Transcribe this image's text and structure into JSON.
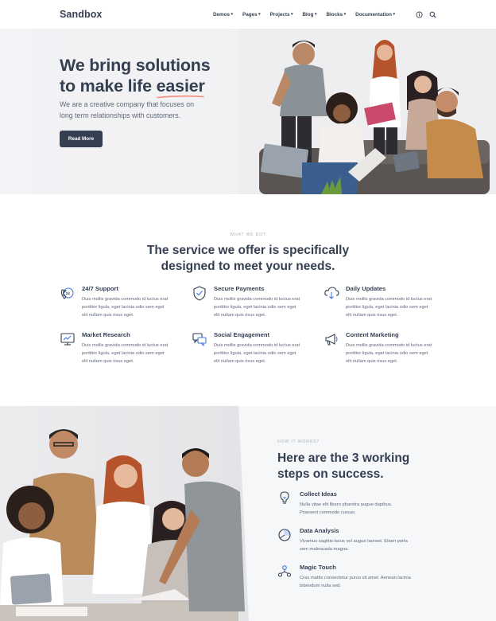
{
  "header": {
    "logo": "Sandbox",
    "nav": [
      {
        "label": "Demos"
      },
      {
        "label": "Pages"
      },
      {
        "label": "Projects"
      },
      {
        "label": "Blog"
      },
      {
        "label": "Blocks"
      },
      {
        "label": "Documentation"
      }
    ],
    "icons": [
      "info-icon",
      "search-icon"
    ]
  },
  "hero": {
    "title_line1": "We bring solutions",
    "title_line2_prefix": "to make life ",
    "title_line2_highlight": "easier",
    "subtitle": "We are a creative company that focuses on long term relationships with customers.",
    "button": "Read More",
    "accent_color": "#f78b77"
  },
  "services": {
    "eyebrow": "WHAT WE DO?",
    "title_line1": "The service we offer is specifically",
    "title_line2": "designed to meet your needs.",
    "items": [
      {
        "title": "24/7 Support",
        "text": "Duis mollis gravida commodo id luctus erat porttitor ligula, eget lacinia odio sem eget elit nullam quis risus eget.",
        "icon": "phone-24-icon"
      },
      {
        "title": "Secure Payments",
        "text": "Duis mollis gravida commodo id luctus erat porttitor ligula, eget lacinia odio sem eget elit nullam quis risus eget.",
        "icon": "shield-check-icon"
      },
      {
        "title": "Daily Updates",
        "text": "Duis mollis gravida commodo id luctus erat porttitor ligula, eget lacinia odio sem eget elit nullam quis risus eget.",
        "icon": "cloud-download-icon"
      },
      {
        "title": "Market Research",
        "text": "Duis mollis gravida commodo id luctus erat porttitor ligula, eget lacinia odio sem eget elit nullam quis risus eget.",
        "icon": "monitor-chart-icon"
      },
      {
        "title": "Social Engagement",
        "text": "Duis mollis gravida commodo id luctus erat porttitor ligula, eget lacinia odio sem eget elit nullam quis risus eget.",
        "icon": "chat-bubbles-icon"
      },
      {
        "title": "Content Marketing",
        "text": "Duis mollis gravida commodo id luctus erat porttitor ligula, eget lacinia odio sem eget elit nullam quis risus eget.",
        "icon": "megaphone-icon"
      }
    ]
  },
  "how": {
    "eyebrow": "HOW IT WORKS?",
    "title_line1": "Here are the 3 working",
    "title_line2": "steps on success.",
    "steps": [
      {
        "title": "Collect Ideas",
        "text": "Nulla vitae elit libero pharetra augue dapibus. Praesent commodo cursus.",
        "icon": "lightbulb-icon"
      },
      {
        "title": "Data Analysis",
        "text": "Vivamus sagittis lacus vel augue laoreet. Etiam porta sem malesuada magna.",
        "icon": "pie-chart-icon"
      },
      {
        "title": "Magic Touch",
        "text": "Cras mattis consectetur purus sit amet. Aenean lacinia bibendum nulla sed.",
        "icon": "network-icon"
      }
    ]
  },
  "colors": {
    "dark": "#343f52",
    "muted": "#60697b",
    "icon_accent": "#343f52",
    "underline": "#f78b77"
  }
}
